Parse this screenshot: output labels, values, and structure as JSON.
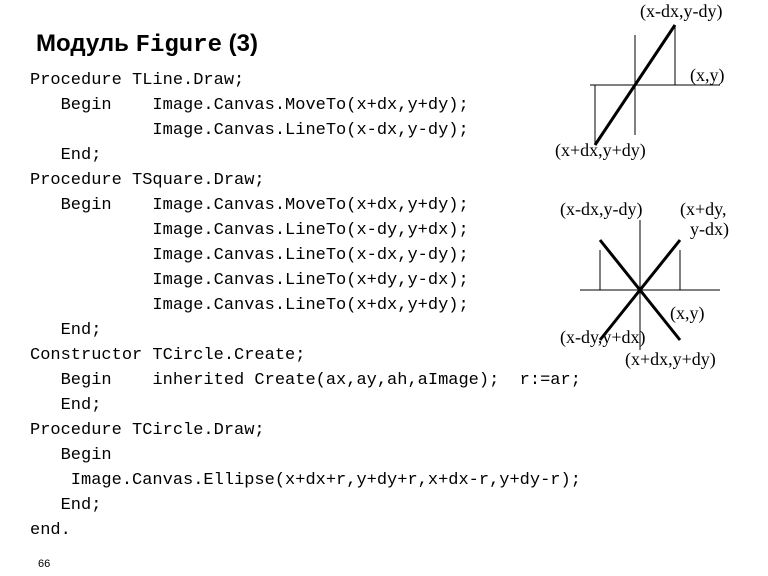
{
  "title_prefix": "Модуль ",
  "title_kw": "Figure",
  "title_suffix": " (3)",
  "code": "Procedure TLine.Draw;\n   Begin    Image.Canvas.MoveTo(x+dx,y+dy);\n            Image.Canvas.LineTo(x-dx,y-dy);\n   End;\nProcedure TSquare.Draw;\n   Begin    Image.Canvas.MoveTo(x+dx,y+dy);\n            Image.Canvas.LineTo(x-dy,y+dx);\n            Image.Canvas.LineTo(x-dx,y-dy);\n            Image.Canvas.LineTo(x+dy,y-dx);\n            Image.Canvas.LineTo(x+dx,y+dy);\n   End;\nConstructor TCircle.Create;\n   Begin    inherited Create(ax,ay,ah,aImage);  r:=ar;\n   End;\nProcedure TCircle.Draw;\n   Begin\n    Image.Canvas.Ellipse(x+dx+r,y+dy+r,x+dx-r,y+dy-r);\n   End;\nend.",
  "pagenum": "66",
  "diag1": {
    "tl": "(x-dx,y-dy)",
    "c": "(x,y)",
    "br": "(x+dx,y+dy)"
  },
  "diag2": {
    "tl": "(x-dx,y-dy)",
    "tr1": "(x+dy,",
    "tr2": "y-dx)",
    "c": "(x,y)",
    "bl": "(x-dy,y+dx)",
    "br": "(x+dx,y+dy)"
  }
}
